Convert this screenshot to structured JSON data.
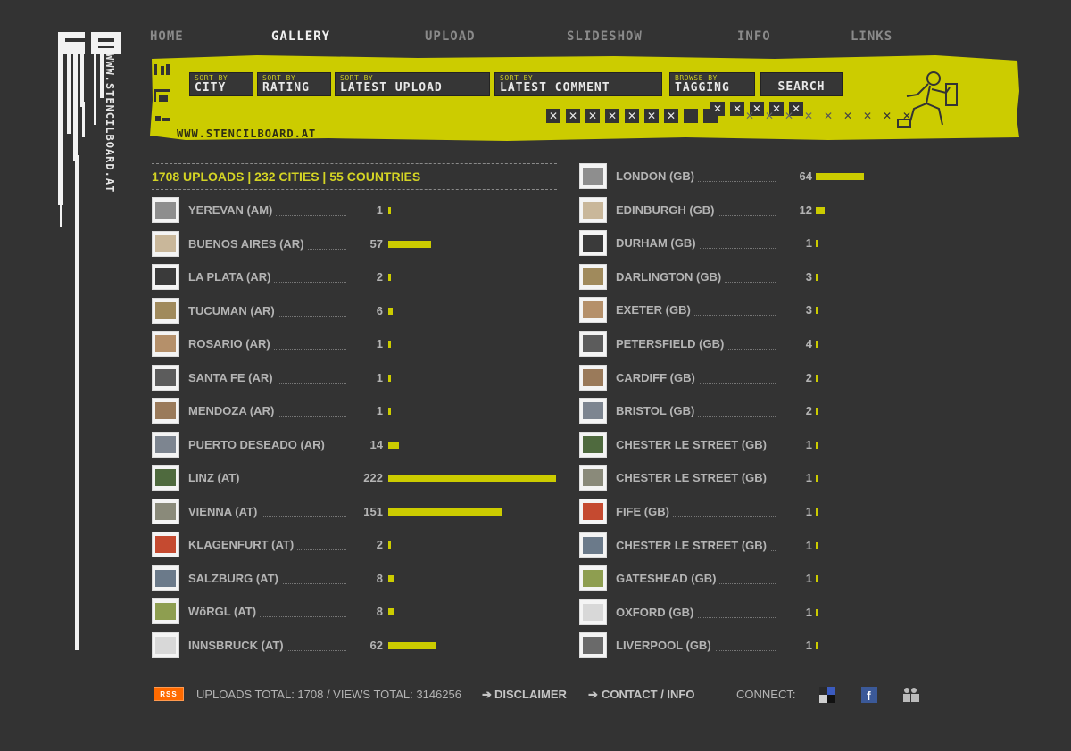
{
  "site": {
    "logo_text": "SB",
    "vertical_url": "WWW.STENCILBOARD.AT"
  },
  "nav": {
    "items": [
      {
        "label": "HOME",
        "active": false
      },
      {
        "label": "GALLERY",
        "active": true
      },
      {
        "label": "UPLOAD",
        "active": false
      },
      {
        "label": "SLIDESHOW",
        "active": false
      },
      {
        "label": "INFO",
        "active": false
      },
      {
        "label": "LINKS",
        "active": false
      }
    ]
  },
  "banner": {
    "sort_buttons": [
      {
        "small": "SORT BY",
        "big": "CITY"
      },
      {
        "small": "SORT BY",
        "big": "RATING"
      },
      {
        "small": "SORT BY",
        "big": "LATEST UPLOAD"
      },
      {
        "small": "SORT BY",
        "big": "LATEST COMMENT"
      },
      {
        "small": "BROWSE BY",
        "big": "TAGGING"
      }
    ],
    "search_label": "SEARCH",
    "url": "WWW.STENCILBOARD.AT",
    "accent_color": "#cccc00"
  },
  "stats": {
    "text": "1708 UPLOADS  |  232 CITIES  |  55 COUNTRIES"
  },
  "cities_left": [
    {
      "name": "YEREVAN (AM)",
      "count": 1
    },
    {
      "name": "BUENOS AIRES (AR)",
      "count": 57
    },
    {
      "name": "LA PLATA (AR)",
      "count": 2
    },
    {
      "name": "TUCUMAN (AR)",
      "count": 6
    },
    {
      "name": "ROSARIO (AR)",
      "count": 1
    },
    {
      "name": "SANTA FE (AR)",
      "count": 1
    },
    {
      "name": "MENDOZA (AR)",
      "count": 1
    },
    {
      "name": "PUERTO DESEADO (AR)",
      "count": 14
    },
    {
      "name": "LINZ (AT)",
      "count": 222
    },
    {
      "name": "VIENNA (AT)",
      "count": 151
    },
    {
      "name": "KLAGENFURT (AT)",
      "count": 2
    },
    {
      "name": "SALZBURG (AT)",
      "count": 8
    },
    {
      "name": "WöRGL (AT)",
      "count": 8
    },
    {
      "name": "INNSBRUCK (AT)",
      "count": 62
    }
  ],
  "cities_right": [
    {
      "name": "LONDON (GB)",
      "count": 64
    },
    {
      "name": "EDINBURGH (GB)",
      "count": 12
    },
    {
      "name": "DURHAM (GB)",
      "count": 1
    },
    {
      "name": "DARLINGTON (GB)",
      "count": 3
    },
    {
      "name": "EXETER (GB)",
      "count": 3
    },
    {
      "name": "PETERSFIELD (GB)",
      "count": 4
    },
    {
      "name": "CARDIFF (GB)",
      "count": 2
    },
    {
      "name": "BRISTOL (GB)",
      "count": 2
    },
    {
      "name": "CHESTER LE STREET (GB)",
      "count": 1
    },
    {
      "name": "CHESTER LE STREET (GB)",
      "count": 1
    },
    {
      "name": "FIFE (GB)",
      "count": 1
    },
    {
      "name": "CHESTER LE STREET (GB)",
      "count": 1
    },
    {
      "name": "GATESHEAD (GB)",
      "count": 1
    },
    {
      "name": "OXFORD (GB)",
      "count": 1
    },
    {
      "name": "LIVERPOOL (GB)",
      "count": 1
    }
  ],
  "footer": {
    "rss_label": "RSS",
    "totals": "UPLOADS TOTAL: 1708 / VIEWS TOTAL: 3146256",
    "disclaimer": "DISCLAIMER",
    "contact": "CONTACT / INFO",
    "connect": "CONNECT:",
    "social_icons": [
      "delicious-icon",
      "facebook-icon",
      "myspace-icon"
    ]
  }
}
